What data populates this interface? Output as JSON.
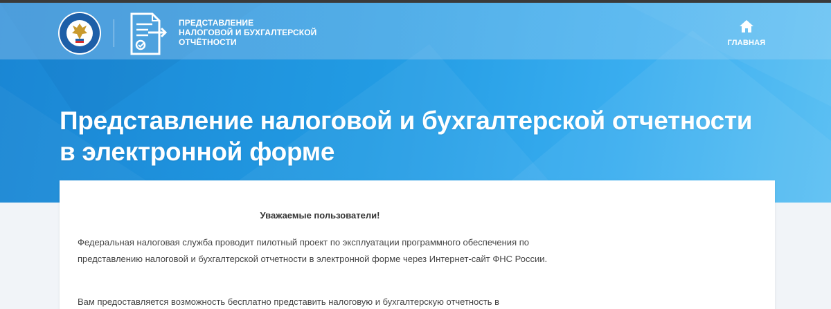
{
  "header": {
    "logo_icon": "fns-emblem-icon",
    "service_icon": "document-arrow-icon",
    "service_title_lines": [
      "ПРЕДСТАВЛЕНИЕ",
      "НАЛОГОВОЙ И БУХГАЛТЕРСКОЙ",
      "ОТЧЁТНОСТИ"
    ],
    "nav": {
      "home_icon": "home-icon",
      "home_label": "ГЛАВНАЯ"
    }
  },
  "hero": {
    "title": "Представление налоговой и бухгалтерской отчетности в электронной форме"
  },
  "content": {
    "heading": "Уважаемые пользователи!",
    "paragraphs": [
      "Федеральная налоговая служба проводит пилотный проект по эксплуатации программного обеспечения по представлению налоговой и бухгалтерской отчетности в электронной форме через Интернет-сайт ФНС России.",
      "Вам предоставляется возможность бесплатно представить налоговую и бухгалтерскую отчетность в"
    ]
  },
  "colors": {
    "hero_start": "#1a86d4",
    "hero_end": "#5cc0f3",
    "page_background": "#f1f4f8",
    "text": "#444444"
  }
}
